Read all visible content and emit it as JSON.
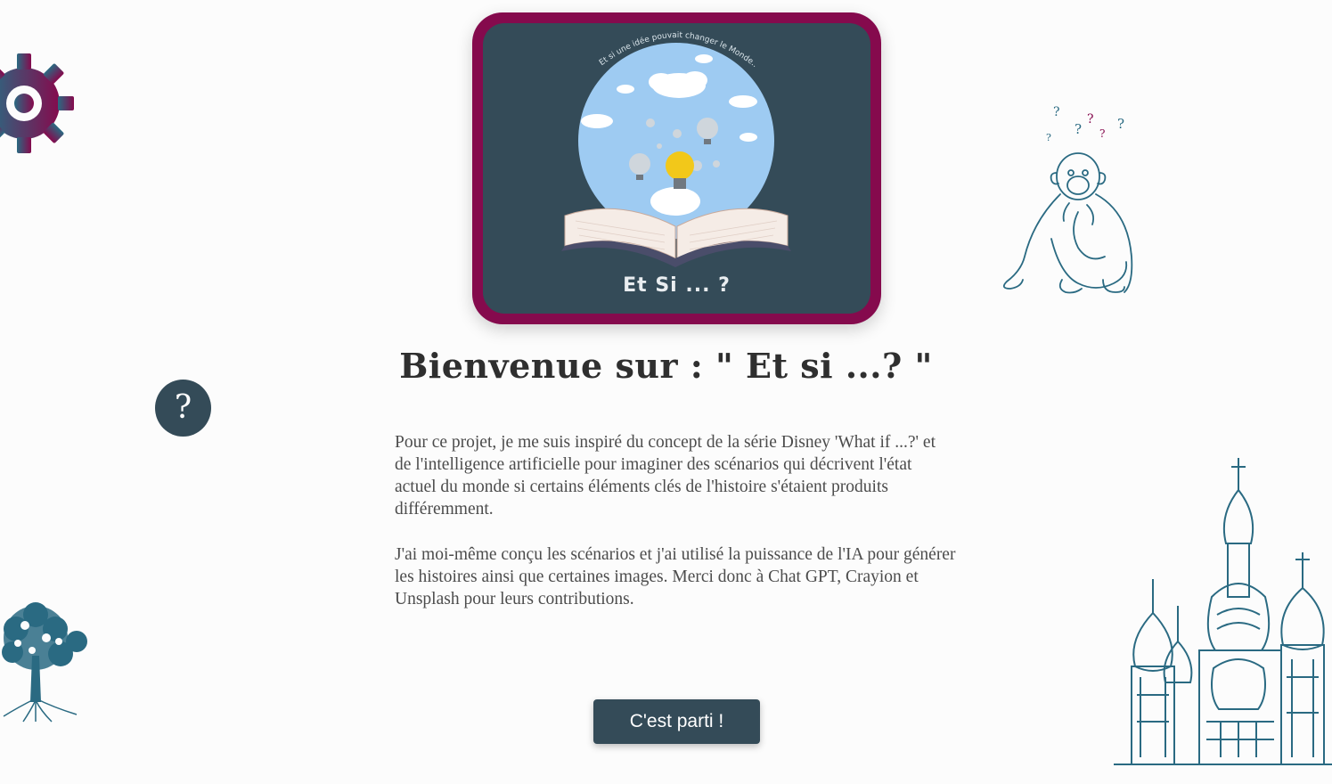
{
  "logo": {
    "arc_text": "Et si une idée pouvait changer le Monde... ?",
    "word": "Et Si ... ?",
    "border_color": "#850a4d",
    "inner_color": "#344b58"
  },
  "title": "Bienvenue sur : \" Et si ...? \"",
  "paragraphs": [
    "Pour ce projet, je me suis inspiré du concept de la série Disney 'What if ...?' et de l'intelligence artificielle pour imaginer des scénarios qui décrivent l'état actuel du monde si certains éléments clés de l'histoire s'étaient produits différemment.",
    "J'ai moi-même conçu les scénarios et j'ai utilisé la puissance de l'IA pour générer les histoires ainsi que certaines images. Merci donc à Chat GPT, Crayion et Unsplash pour leurs contributions."
  ],
  "start_button": "C'est parti !",
  "help_button": "?",
  "decorations": {
    "gear": "gear-icon",
    "monkey": "monkey-icon",
    "tree": "tree-icon",
    "cathedral": "cathedral-icon",
    "accent_teal": "#2a6a82",
    "accent_plum": "#850a4d"
  }
}
